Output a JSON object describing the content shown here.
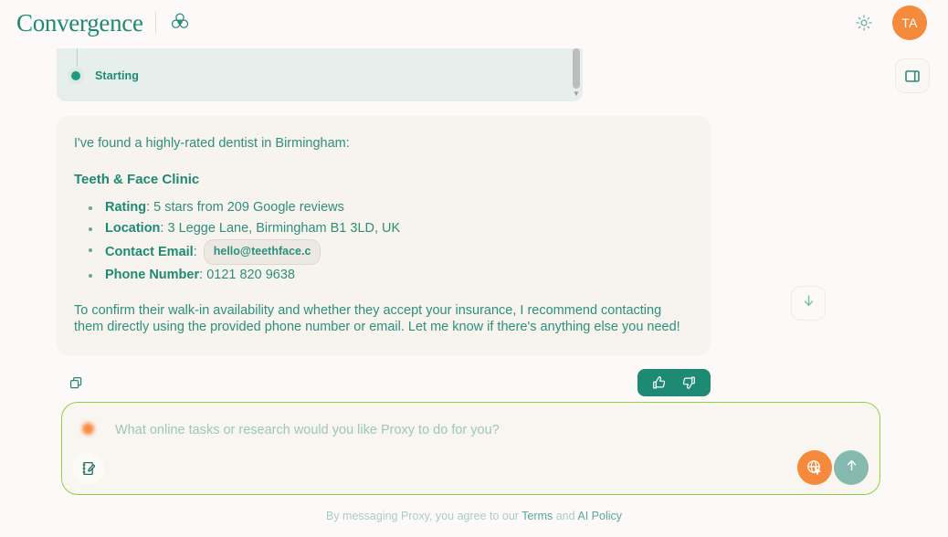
{
  "header": {
    "brand_name": "Convergence",
    "brand_mark_icon": "triquetra-logo-icon",
    "theme_toggle_icon": "sun-icon",
    "avatar_initials": "TA"
  },
  "panel_toggle": {
    "icon": "panel-layout-icon"
  },
  "timeline": {
    "status_label": "Starting",
    "scroll_indicator_icon": "chevron-down-icon"
  },
  "message": {
    "intro": "I've found a highly-rated dentist in Birmingham:",
    "clinic_name": "Teeth & Face Clinic",
    "facts": [
      {
        "label": "Rating",
        "sep": ": ",
        "value": "5 stars from 209 Google reviews",
        "chip": null
      },
      {
        "label": "Location",
        "sep": ": ",
        "value": "3 Legge Lane, Birmingham B1 3LD, UK",
        "chip": null
      },
      {
        "label": "Contact Email",
        "sep": ": ",
        "value": "",
        "chip": "hello@teethface.c"
      },
      {
        "label": "Phone Number",
        "sep": ": ",
        "value": "0121 820 9638",
        "chip": null
      }
    ],
    "outro": "To confirm their walk-in availability and whether they accept your insurance, I recommend contacting them directly using the provided phone number or email. Let me know if there's anything else you need!"
  },
  "actions": {
    "copy_icon": "copy-icon",
    "thumbs_up_icon": "thumbs-up-icon",
    "thumbs_down_icon": "thumbs-down-icon",
    "scroll_down_icon": "arrow-down-icon"
  },
  "composer": {
    "placeholder": "What online tasks or research would you like Proxy to do for you?",
    "value": "",
    "status_dot_icon": "orange-status-dot-icon",
    "notes_icon": "note-edit-icon",
    "browse_icon": "globe-cursor-icon",
    "send_icon": "arrow-up-icon"
  },
  "footer": {
    "prefix": "By messaging Proxy, you agree to our ",
    "terms_label": "Terms",
    "middle": " and ",
    "policy_label": "AI Policy"
  },
  "colors": {
    "page_bg": "#fdf9f8",
    "bubble_bg": "#f7f3ee",
    "teal": "#1f8a74",
    "teal_text": "#2f8f7d",
    "mint_panel": "#e6efeb",
    "orange": "#f58a3c",
    "green_border": "#8ed33f",
    "send_teal": "#86b9b0"
  }
}
